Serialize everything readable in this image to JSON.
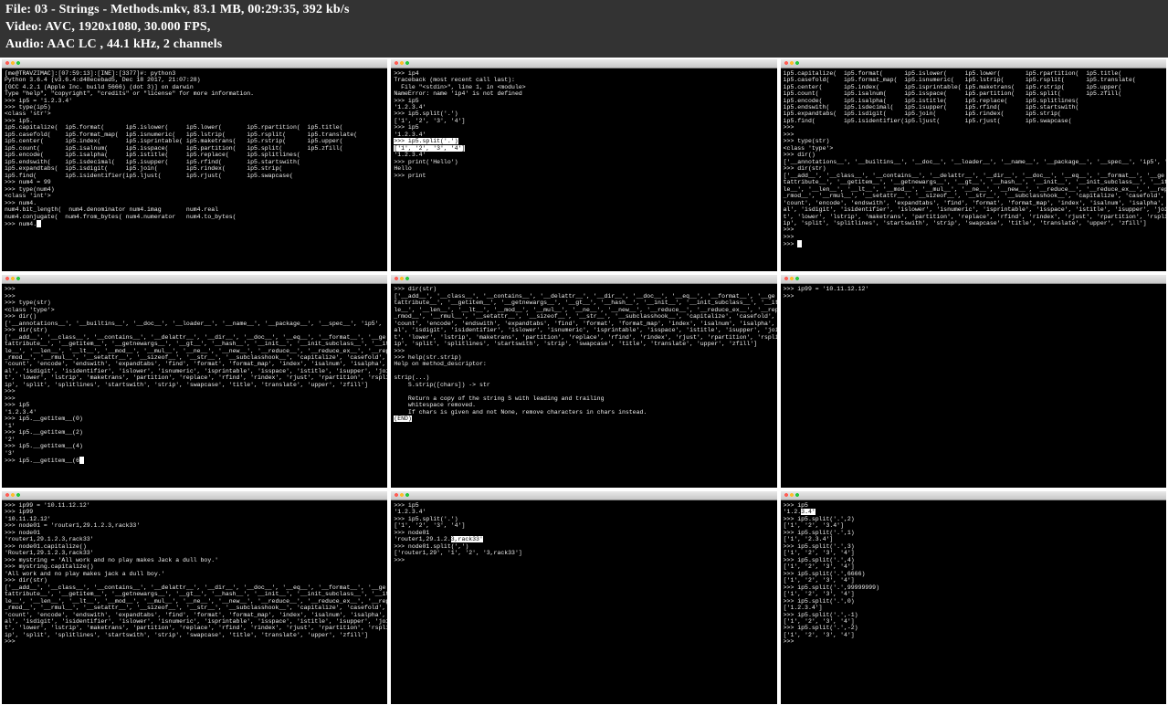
{
  "header": {
    "line1": "File: 03 - Strings - Methods.mkv, 83.1 MB, 00:29:35, 392 kb/s",
    "line2": "Video: AVC, 1920x1080, 30.000 FPS,",
    "line3": "Audio: AAC LC , 44.1 kHz, 2 channels"
  },
  "frames": {
    "f1": "[me@TRAVZIMAC]:[07:59:13]:[INE]:[3377]#: python3\nPython 3.6.4 (v3.6.4:d48ecebad5, Dec 18 2017, 21:07:28)\n[GCC 4.2.1 (Apple Inc. build 5666) (dot 3)] on darwin\nType \"help\", \"copyright\", \"credits\" or \"license\" for more information.\n>>> ip5 = '1.2.3.4'\n>>> type(ip5)\n<class 'str'>\n>>> ip5.\nip5.capitalize(  ip5.format(      ip5.islower(     ip5.lower(       ip5.rpartition(  ip5.title(\nip5.casefold(    ip5.format_map(  ip5.isnumeric(   ip5.lstrip(      ip5.rsplit(      ip5.translate(\nip5.center(      ip5.index(       ip5.isprintable( ip5.maketrans(   ip5.rstrip(      ip5.upper(\nip5.count(       ip5.isalnum(     ip5.isspace(     ip5.partition(   ip5.split(       ip5.zfill(\nip5.encode(      ip5.isalpha(     ip5.istitle(     ip5.replace(     ip5.splitlines(\nip5.endswith(    ip5.isdecimal(   ip5.isupper(     ip5.rfind(       ip5.startswith(\nip5.expandtabs(  ip5.isdigit(     ip5.join(        ip5.rindex(      ip5.strip(\nip5.find(        ip5.isidentifier(ip5.ljust(       ip5.rjust(       ip5.swapcase(\n>>> num4 = 99\n>>> type(num4)\n<class 'int'>\n>>> num4.\nnum4.bit_length(  num4.denominator num4.imag       num4.real\nnum4.conjugate(  num4.from_bytes( num4.numerator   num4.to_bytes(\n>>> num4.",
    "f1_hl": "format(",
    "f2a": ">>> ip4\nTraceback (most recent call last):\n  File \"<stdin>\", line 1, in <module>\nNameError: name 'ip4' is not defined\n>>> ip5\n'1.2.3.4'\n>>> ip5.split('.')\n['1', '2', '3', '4']\n>>> ip5\n'1.2.3.4'\n",
    "f2_hl": ">>> ip5.split('.')\n['1', '2', '3', '4']",
    "f2b": "\n'1.2.3.4'\n>>> print('Hello')\nHello\n>>> print",
    "f3": "ip5.capitalize(  ip5.format(      ip5.islower(     ip5.lower(       ip5.rpartition(  ip5.title(\nip5.casefold(    ip5.format_map(  ip5.isnumeric(   ip5.lstrip(      ip5.rsplit(      ip5.translate(\nip5.center(      ip5.index(       ip5.isprintable( ip5.maketrans(   ip5.rstrip(      ip5.upper(\nip5.count(       ip5.isalnum(     ip5.isspace(     ip5.partition(   ip5.split(       ip5.zfill(\nip5.encode(      ip5.isalpha(     ip5.istitle(     ip5.replace(     ip5.splitlines(\nip5.endswith(    ip5.isdecimal(   ip5.isupper(     ip5.rfind(       ip5.startswith(\nip5.expandtabs(  ip5.isdigit(     ip5.join(        ip5.rindex(      ip5.strip(\nip5.find(        ip5.isidentifier(ip5.ljust(       ip5.rjust(       ip5.swapcase(\n>>>\n>>>\n>>> type(str)\n<class 'type'>\n>>> dir()\n['__annotations__', '__builtins__', '__doc__', '__loader__', '__name__', '__package__', '__spec__', 'ip5', 'num4']\n>>> dir(str)\n['__add__', '__class__', '__contains__', '__delattr__', '__dir__', '__doc__', '__eq__', '__format__', '__ge\ntattribute__', '__getitem__', '__getnewargs__', '__gt__', '__hash__', '__init__', '__init_subclass__', '__iter__\nle__', '__len__', '__lt__', '__mod__', '__mul__', '__ne__', '__new__', '__reduce__', '__reduce_ex__', '__repr__'\n_rmod__', '__rmul__', '__setattr__', '__sizeof__', '__str__', '__subclasshook__', 'capitalize', 'casefold', 'center',\n'count', 'encode', 'endswith', 'expandtabs', 'find', 'format', 'format_map', 'index', 'isalnum', 'isalpha', 'isdecim\nal', 'isdigit', 'isidentifier', 'islower', 'isnumeric', 'isprintable', 'isspace', 'istitle', 'isupper', 'join', 'ljus\nt', 'lower', 'lstrip', 'maketrans', 'partition', 'replace', 'rfind', 'rindex', 'rjust', 'rpartition', 'rsplit', 'rstr\nip', 'split', 'splitlines', 'startswith', 'strip', 'swapcase', 'title', 'translate', 'upper', 'zfill']\n>>>\n>>>\n>>> ",
    "f4": ">>>\n>>>\n>>> type(str)\n<class 'type'>\n>>> dir()\n['__annotations__', '__builtins__', '__doc__', '__loader__', '__name__', '__package__', '__spec__', 'ip5', 'num4']\n>>> dir(str)\n['__add__', '__class__', '__contains__', '__delattr__', '__dir__', '__doc__', '__eq__', '__format__', '__ge\ntattribute__', '__getitem__', '__getnewargs__', '__gt__', '__hash__', '__init__', '__init_subclass__', '__iter__\nle__', '__len__', '__lt__', '__mod__', '__mul__', '__ne__', '__new__', '__reduce__', '__reduce_ex__', '__repr__'\n_rmod__', '__rmul__', '__setattr__', '__sizeof__', '__str__', '__subclasshook__', 'capitalize', 'casefold', 'center',\n'count', 'encode', 'endswith', 'expandtabs', 'find', 'format', 'format_map', 'index', 'isalnum', 'isalpha', 'isdecim\nal', 'isdigit', 'isidentifier', 'islower', 'isnumeric', 'isprintable', 'isspace', 'istitle', 'isupper', 'join', 'ljus\nt', 'lower', 'lstrip', 'maketrans', 'partition', 'replace', 'rfind', 'rindex', 'rjust', 'rpartition', 'rsplit', 'rstr\nip', 'split', 'splitlines', 'startswith', 'strip', 'swapcase', 'title', 'translate', 'upper', 'zfill']\n>>>\n>>>\n>>> ip5\n'1.2.3.4'\n>>> ip5.__getitem__(0)\n'1'\n>>> ip5.__getitem__(2)\n'2'\n>>> ip5.__getitem__(4)\n'3'\n>>> ip5.__getitem__(6",
    "f5a": ">>> dir(str)\n['__add__', '__class__', '__contains__', '__delattr__', '__dir__', '__doc__', '__eq__', '__format__', '__ge\ntattribute__', '__getitem__', '__getnewargs__', '__gt__', '__hash__', '__init__', '__init_subclass__', '__iter__\nle__', '__len__', '__lt__', '__mod__', '__mul__', '__ne__', '__new__', '__reduce__', '__reduce_ex__', '__repr__'\n_rmod__', '__rmul__', '__setattr__', '__sizeof__', '__str__', '__subclasshook__', 'capitalize', 'casefold', 'center',\n'count', 'encode', 'endswith', 'expandtabs', 'find', 'format', 'format_map', 'index', 'isalnum', 'isalpha', 'isdecim\nal', 'isdigit', 'isidentifier', 'islower', 'isnumeric', 'isprintable', 'isspace', 'istitle', 'isupper', 'join', 'ljus\nt', 'lower', 'lstrip', 'maketrans', 'partition', 'replace', 'rfind', 'rindex', 'rjust', 'rpartition', 'rsplit', 'rstr\nip', 'split', 'splitlines', 'startswith', 'strip', 'swapcase', 'title', 'translate', 'upper', 'zfill']\n>>>\n>>> help(str.strip)\nHelp on method_descriptor:\n\nstrip(...)\n    S.strip([chars]) -> str\n\n    Return a copy of the string S with leading and trailing\n    whitespace removed.\n    If chars is given and not None, remove characters in chars instead.\n",
    "f5_hl": "(END)",
    "f6": ">>> ip99 = '10.11.12.12'\n>>> ",
    "f7": ">>> ip99 = '10.11.12.12'\n>>> ip99\n'10.11.12.12'\n>>> node01 = 'router1,29.1.2.3,rack33'\n>>> node01\n'router1,29.1.2.3,rack33'\n>>> node01.capitalize()\n'Router1,29.1.2.3,rack33'\n>>> mystring = 'All work and no play makes Jack a dull boy.'\n>>> mystring.capitalize()\n'All work and no play makes jack a dull boy.'\n>>> dir(str)\n['__add__', '__class__', '__contains__', '__delattr__', '__dir__', '__doc__', '__eq__', '__format__', '__ge\ntattribute__', '__getitem__', '__getnewargs__', '__gt__', '__hash__', '__init__', '__init_subclass__', '__iter__\nle__', '__len__', '__lt__', '__mod__', '__mul__', '__ne__', '__new__', '__reduce__', '__reduce_ex__', '__repr__'\n_rmod__', '__rmul__', '__setattr__', '__sizeof__', '__str__', '__subclasshook__', 'capitalize', 'casefold', 'center',\n'count', 'encode', 'endswith', 'expandtabs', 'find', 'format', 'format_map', 'index', 'isalnum', 'isalpha', 'isdecim\nal', 'isdigit', 'isidentifier', 'islower', 'isnumeric', 'isprintable', 'isspace', 'istitle', 'isupper', 'join', 'ljus\nt', 'lower', 'lstrip', 'maketrans', 'partition', 'replace', 'rfind', 'rindex', 'rjust', 'rpartition', 'rsplit', 'rstr\nip', 'split', 'splitlines', 'startswith', 'strip', 'swapcase', 'title', 'translate', 'upper', 'zfill']\n>>>",
    "f8a": ">>> ip5\n'1.2.3.4'\n>>> ip5.split('.')\n['1', '2', '3', '4']\n>>> node01\n'router1,29.1.2.",
    "f8_hl": "3,rack33'",
    "f8b": "\n>>> node01.split(',')\n['router1,29', '1', '2', '3,rack33']\n>>>",
    "f9a": ">>> ip5\n'1.2.",
    "f9_hl": "3.4'",
    "f9b": "\n>>> ip5.split('.',2)\n['1', '2', '3.4']\n>>> ip5.split('.',1)\n['1', '2.3.4']\n>>> ip5.split('.',3)\n['1', '2', '3', '4']\n>>> ip5.split('.',4)\n['1', '2', '3', '4']\n>>> ip5.split('.',6666)\n['1', '2', '3', '4']\n>>> ip5.split('.',99999999)\n['1', '2', '3', '4']\n>>> ip5.split('.',0)\n['1.2.3.4']\n>>> ip5.split('.',-1)\n['1', '2', '3', '4']\n>>> ip5.split('.',-2)\n['1', '2', '3', '4']\n>>> "
  }
}
